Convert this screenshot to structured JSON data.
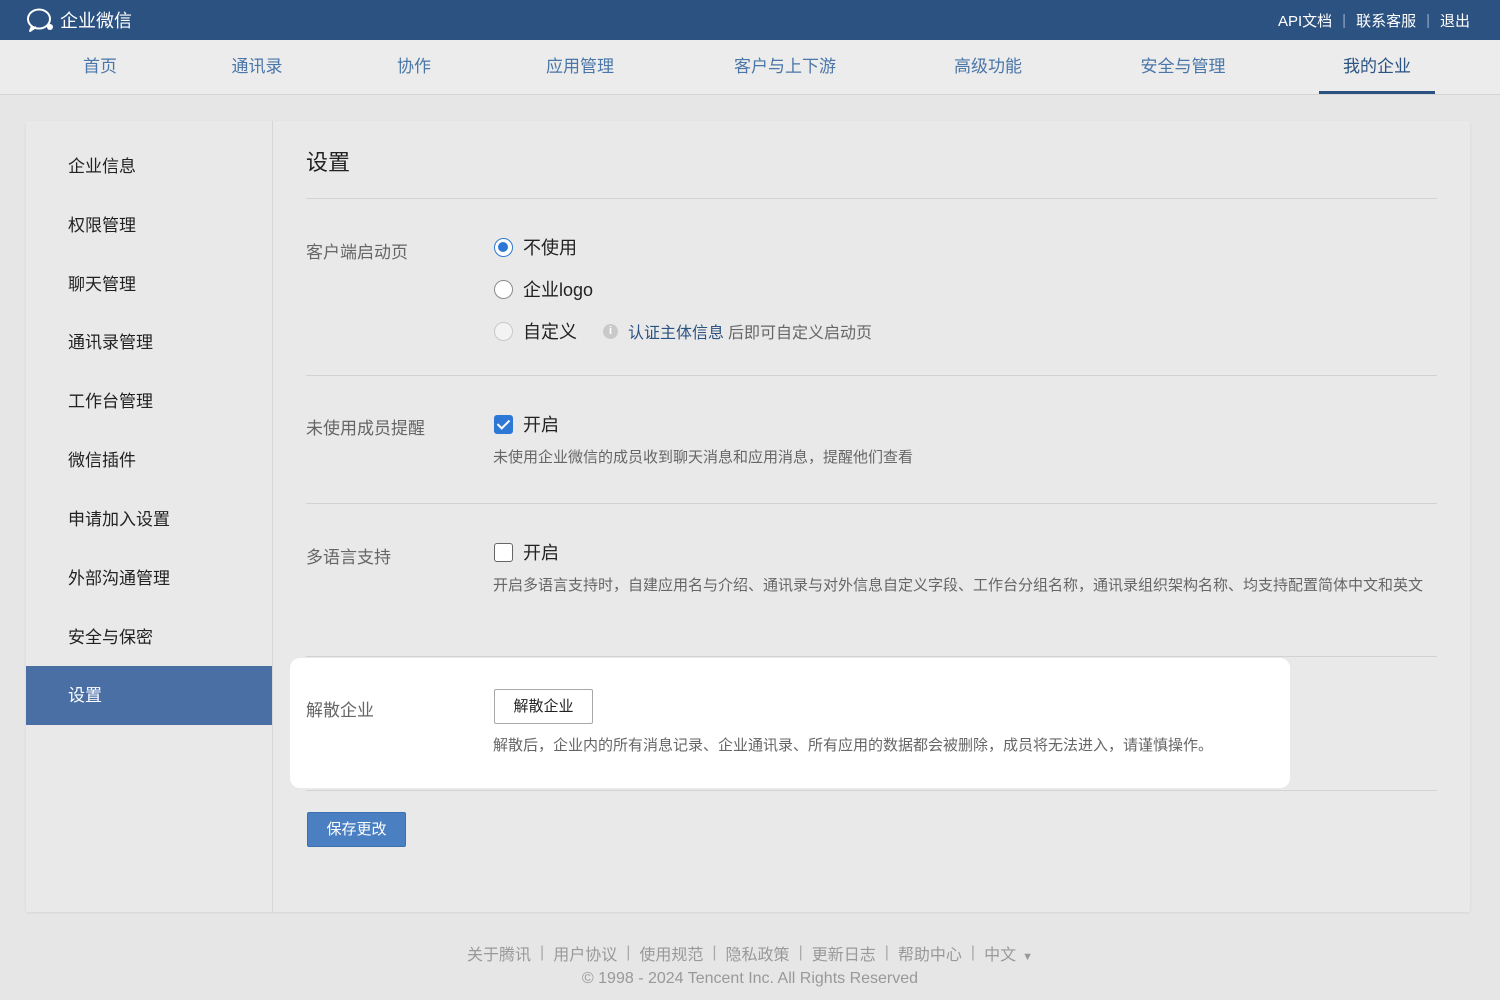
{
  "topbar": {
    "logo_text": "企业微信",
    "links": [
      "API文档",
      "联系客服",
      "退出"
    ]
  },
  "nav": {
    "items": [
      "首页",
      "通讯录",
      "协作",
      "应用管理",
      "客户与上下游",
      "高级功能",
      "安全与管理",
      "我的企业"
    ],
    "active": "我的企业"
  },
  "sidebar": {
    "items": [
      "企业信息",
      "权限管理",
      "聊天管理",
      "通讯录管理",
      "工作台管理",
      "微信插件",
      "申请加入设置",
      "外部沟通管理",
      "安全与保密",
      "设置"
    ],
    "active": "设置"
  },
  "settings": {
    "title": "设置",
    "splash": {
      "label": "客户端启动页",
      "options": [
        "不使用",
        "企业logo",
        "自定义"
      ],
      "selected": "不使用",
      "verify_link": "认证主体信息",
      "verify_rest": "后即可自定义启动页"
    },
    "reminder": {
      "label": "未使用成员提醒",
      "checkbox_label": "开启",
      "checked": true,
      "desc": "未使用企业微信的成员收到聊天消息和应用消息，提醒他们查看"
    },
    "multilang": {
      "label": "多语言支持",
      "checkbox_label": "开启",
      "checked": false,
      "desc": "开启多语言支持时，自建应用名与介绍、通讯录与对外信息自定义字段、工作台分组名称，通讯录组织架构名称、均支持配置简体中文和英文"
    },
    "dissolve": {
      "label": "解散企业",
      "button": "解散企业",
      "desc": "解散后，企业内的所有消息记录、企业通讯录、所有应用的数据都会被删除，成员将无法进入，请谨慎操作。"
    },
    "save_button": "保存更改"
  },
  "footer": {
    "links": [
      "关于腾讯",
      "用户协议",
      "使用规范",
      "隐私政策",
      "更新日志",
      "帮助中心"
    ],
    "language": "中文",
    "copyright": "© 1998 - 2024 Tencent Inc. All Rights Reserved"
  },
  "colors": {
    "topbar": "#2b5280",
    "active_sidebar": "#4a6fa5",
    "primary_button": "#4a7fc1",
    "radio_checked": "#2d78d6"
  }
}
